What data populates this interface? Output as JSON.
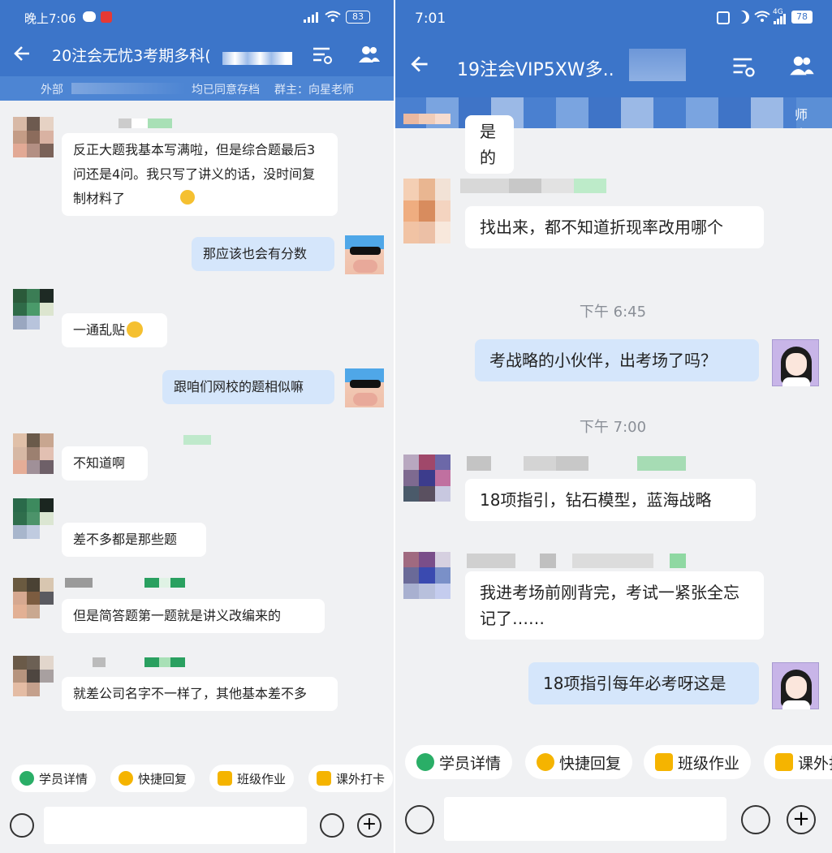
{
  "left": {
    "status": {
      "time": "晚上7:06",
      "battery": "83"
    },
    "title": "20注会无忧3考期多科(",
    "notice": "外部群 · 均已同意存档 | 群主：向星老师",
    "notice_a": "外部",
    "notice_b": "均已同意存档",
    "notice_c": "群主：向星老师",
    "messages": [
      {
        "text": "反正大题我基本写满啦，但是综合题最后3问还是4问。我只写了讲义的话，没时间复制材料了"
      },
      {
        "text": "那应该也会有分数"
      },
      {
        "text": "一通乱贴"
      },
      {
        "text": "跟咱们网校的题相似嘛"
      },
      {
        "text": "不知道啊"
      },
      {
        "text": "差不多都是那些题"
      },
      {
        "text": "但是简答题第一题就是讲义改编来的"
      },
      {
        "text": "就差公司名字不一样了，其他基本差不多"
      }
    ],
    "toolbar": [
      "学员详情",
      "快捷回复",
      "班级作业",
      "课外打卡"
    ]
  },
  "right": {
    "status": {
      "time": "7:01",
      "battery": "78",
      "network": "4G"
    },
    "title": "19注会VIP5XW多..",
    "notice_tail": "师小...",
    "messages": [
      {
        "text": "是的"
      },
      {
        "text": "找出来，都不知道折现率改用哪个"
      },
      {
        "time": "下午 6:45"
      },
      {
        "text": "考战略的小伙伴，出考场了吗？"
      },
      {
        "time": "下午 7:00"
      },
      {
        "text": "18项指引，钻石模型，蓝海战略"
      },
      {
        "text": "我进考场前刚背完，考试一紧张全忘记了……"
      },
      {
        "text": "18项指引每年必考呀这是"
      }
    ],
    "toolbar": [
      "学员详情",
      "快捷回复",
      "班级作业",
      "课外打"
    ]
  },
  "colors": {
    "header": "#3c75c9",
    "bubble_me": "#d5e6fb",
    "bubble_other": "#ffffff",
    "background": "#f0f1f3",
    "green": "#2aae67",
    "yellow": "#f5b400"
  }
}
